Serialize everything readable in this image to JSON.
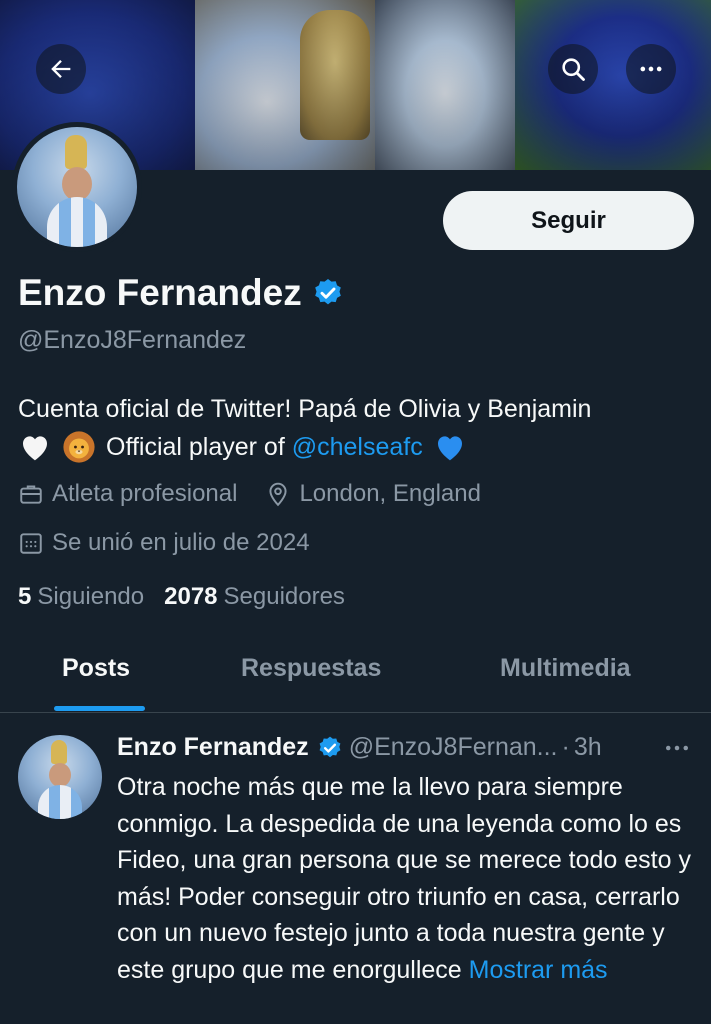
{
  "profile": {
    "follow_label": "Seguir",
    "name": "Enzo Fernandez",
    "handle": "@EnzoJ8Fernandez",
    "bio_line1": "Cuenta oficial de Twitter! Papá de Olivia y Benjamin",
    "bio_line2_text": "Official player of",
    "bio_link": "@chelseafc",
    "bio_emojis": [
      "white-heart",
      "lion-face",
      "blue-heart"
    ],
    "category": "Atleta profesional",
    "location": "London, England",
    "joined": "Se unió en julio de 2024",
    "following_count": "5",
    "following_label": "Siguiendo",
    "followers_count": "2078",
    "followers_label": "Seguidores"
  },
  "tabs": [
    {
      "label": "Posts",
      "active": true
    },
    {
      "label": "Respuestas",
      "active": false
    },
    {
      "label": "Multimedia",
      "active": false
    }
  ],
  "post": {
    "name": "Enzo Fernandez",
    "handle": "@EnzoJ8Fernan...",
    "separator": "·",
    "time": "3h",
    "text": "Otra noche más que me la llevo para siempre conmigo. La despedida de una leyenda como lo es Fideo, una gran persona que se merece todo esto y más! Poder conseguir otro triunfo en casa, cerrarlo con un nuevo festejo junto a toda nuestra gente y este grupo que me enorgullece",
    "show_more": "Mostrar más"
  },
  "colors": {
    "background": "#15202b",
    "accent": "#1d9bf0",
    "secondary_text": "#8b98a5",
    "primary_text": "#f7f9f9",
    "follow_button_bg": "#eff3f4"
  },
  "icons": [
    "back-arrow-icon",
    "search-icon",
    "more-icon",
    "verified-icon",
    "briefcase-icon",
    "location-pin-icon",
    "calendar-icon",
    "more-horizontal-icon"
  ]
}
